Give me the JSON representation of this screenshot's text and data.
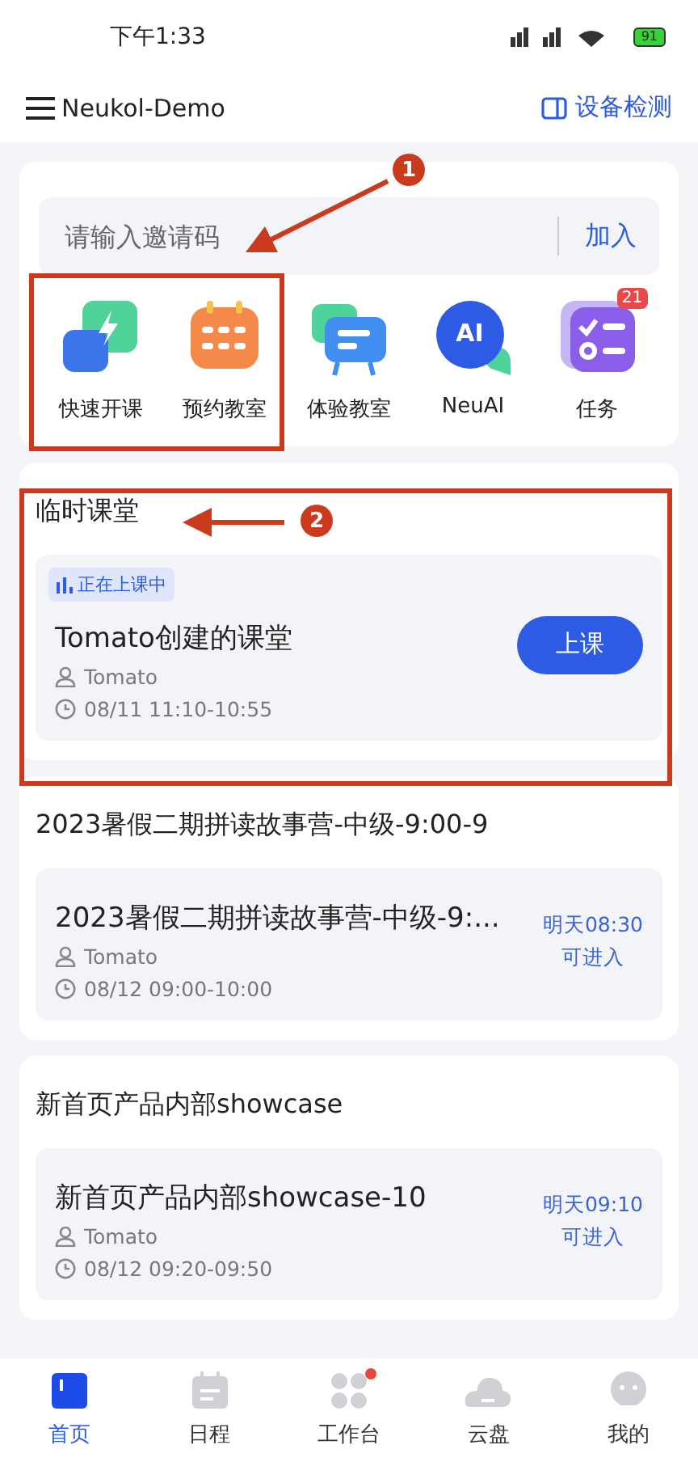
{
  "status_bar": {
    "time": "下午1:33",
    "battery": "91"
  },
  "header": {
    "title": "Neukol-Demo",
    "action": "设备检测"
  },
  "invite": {
    "placeholder": "请输入邀请码",
    "button": "加入"
  },
  "shortcuts": [
    {
      "kind": "bolt",
      "label": "快速开课"
    },
    {
      "kind": "calendar",
      "label": "预约教室"
    },
    {
      "kind": "chat",
      "label": "体验教室"
    },
    {
      "kind": "ai",
      "label": "NeuAI",
      "icon_text": "AI"
    },
    {
      "kind": "task",
      "label": "任务",
      "badge": "21"
    }
  ],
  "sections": [
    {
      "title": "临时课堂",
      "lesson": {
        "status": "正在上课中",
        "name": "Tomato创建的课堂",
        "teacher": "Tomato",
        "time": "08/11 11:10-10:55",
        "action": {
          "kind": "button",
          "text": "上课"
        }
      }
    },
    {
      "title": "2023暑假二期拼读故事营-中级-9:00-9",
      "lesson": {
        "name": "2023暑假二期拼读故事营-中级-9:...",
        "teacher": "Tomato",
        "time": "08/12 09:00-10:00",
        "action": {
          "kind": "note",
          "lines": [
            "明天08:30",
            "可进入"
          ]
        }
      }
    },
    {
      "title": "新首页产品内部showcase",
      "lesson": {
        "name": "新首页产品内部showcase-10",
        "teacher": "Tomato",
        "time": "08/12 09:20-09:50",
        "action": {
          "kind": "note",
          "lines": [
            "明天09:10",
            "可进入"
          ]
        }
      }
    }
  ],
  "nav": [
    {
      "kind": "home",
      "label": "首页",
      "selected": true,
      "dot": false
    },
    {
      "kind": "calendar",
      "label": "日程",
      "selected": false,
      "dot": false
    },
    {
      "kind": "grid",
      "label": "工作台",
      "selected": false,
      "dot": true
    },
    {
      "kind": "cloud",
      "label": "云盘",
      "selected": false,
      "dot": false
    },
    {
      "kind": "face",
      "label": "我的",
      "selected": false,
      "dot": false
    }
  ],
  "annotations": [
    {
      "number": "1"
    },
    {
      "number": "2"
    }
  ]
}
